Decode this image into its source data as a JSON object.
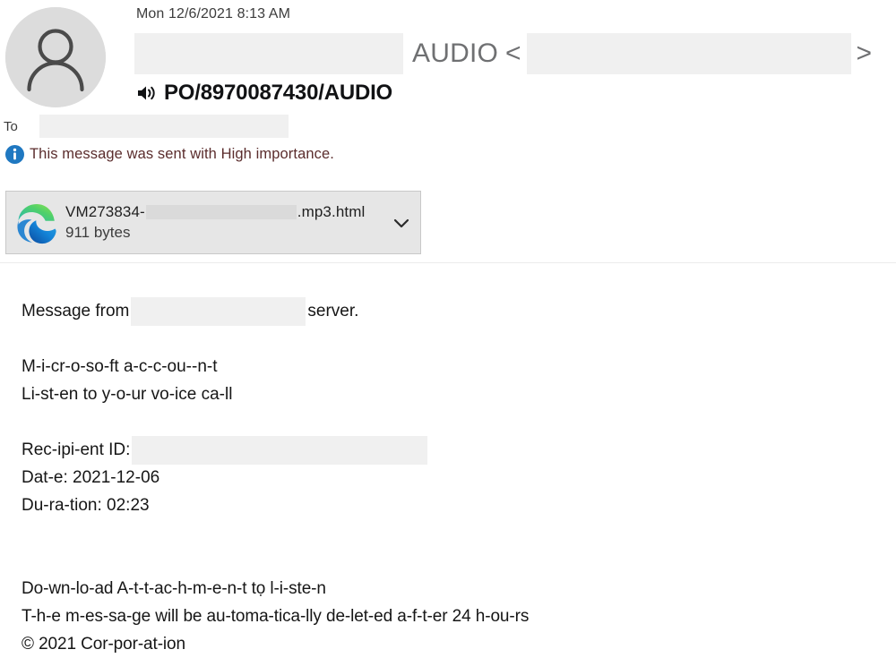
{
  "header": {
    "sent_date": "Mon 12/6/2021 8:13 AM",
    "subject_visible_text": "AUDIO",
    "sender_bracket_open": "<",
    "sender_bracket_close": ">",
    "audio_subject": "PO/8970087430/AUDIO",
    "speaker_icon": "speaker-icon",
    "avatar_icon": "person-avatar-icon",
    "to_label": "To",
    "importance_notice": "This message was sent with High importance.",
    "importance_icon": "info-circle-icon",
    "importance_color": "#5b2d2d"
  },
  "attachment": {
    "icon": "microsoft-edge-icon",
    "name_prefix": "VM273834-",
    "name_suffix": ".mp3.html",
    "size": "911 bytes",
    "expand_icon": "chevron-down-icon"
  },
  "body": {
    "line_message_from_prefix": "Message from",
    "line_message_from_suffix": "server.",
    "line_account": "M-i-cr-o-so-ft a-c-c-ou--n-t",
    "line_listen": "Li-st-en to y-o-ur vo-ice ca-ll",
    "line_recipient_label": "Rec-ipi-ent ID:",
    "line_date": "Dat-e: 2021-12-06",
    "line_duration": "Du-ra-tion: 02:23",
    "line_download": "Do-wn-lo-ad A-t-t-ac-h-m-e-n-t tọ l-i-ste-n",
    "line_autodelete": "T-h-e m-es-sa-ge will be au-toma-tica-lly de-let-ed a-f-t-er 24 h-ou-rs",
    "line_copyright": "© 2021  Cor-por-at-ion"
  },
  "colors": {
    "redaction": "#f0f0f0",
    "attachment_bg": "#e6e6e6",
    "attachment_border": "#c8c8c8",
    "subject_gray": "#6f7072",
    "info_blue": "#1f78c1",
    "edge_blue": "#0f5ca8",
    "edge_green": "#5fd35f"
  }
}
